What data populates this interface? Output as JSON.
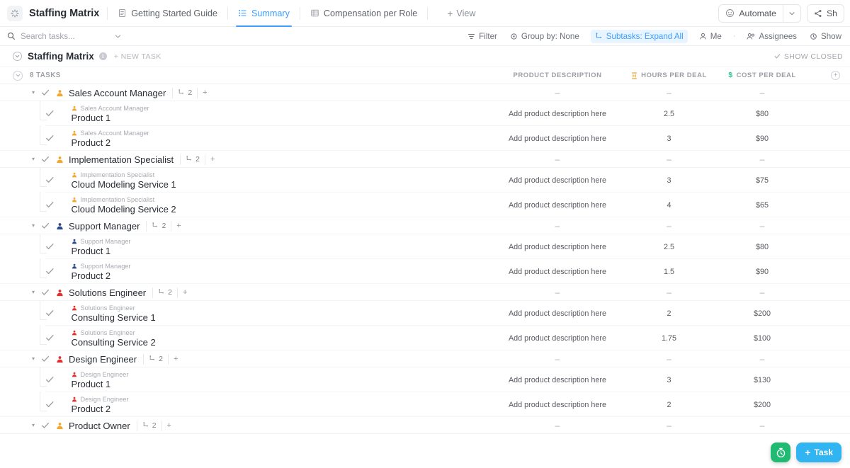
{
  "topbar": {
    "list_title": "Staffing Matrix",
    "tabs": [
      {
        "label": "Getting Started Guide",
        "icon": "doc-icon",
        "active": false
      },
      {
        "label": "Summary",
        "icon": "list-icon",
        "active": true
      },
      {
        "label": "Compensation per Role",
        "icon": "table-icon",
        "active": false
      }
    ],
    "add_view_label": "View",
    "automate_label": "Automate",
    "share_label": "Sh"
  },
  "filterbar": {
    "search_placeholder": "Search tasks...",
    "filter_label": "Filter",
    "group_by_label": "Group by: None",
    "subtasks_label": "Subtasks: Expand All",
    "me_label": "Me",
    "assignees_label": "Assignees",
    "show_label": "Show"
  },
  "listheader": {
    "title": "Staffing Matrix",
    "info_glyph": "i",
    "new_task_label": "+ NEW TASK",
    "show_closed_label": "SHOW CLOSED"
  },
  "columns": {
    "task_count": "8 TASKS",
    "product_description": "PRODUCT DESCRIPTION",
    "hours_per_deal": "HOURS PER DEAL",
    "cost_per_deal": "COST PER DEAL",
    "hours_icon": "hourglass-icon",
    "cost_icon": "dollar-icon",
    "add_column_icon": "plus-circle-icon"
  },
  "empty_value": "–",
  "colors": {
    "accent": "#3c9dff",
    "highlight_bg": "#e8f4ff",
    "fab_green": "#21ba72",
    "fab_blue": "#30b5f2",
    "avatar_orange": "#f0a830",
    "avatar_navy": "#2c4a8c",
    "avatar_red": "#e03131"
  },
  "groups": [
    {
      "name": "Sales Account Manager",
      "avatar": "person-orange-icon",
      "avatar_color": "#f0a830",
      "subtask_count": "2",
      "add_label": "+",
      "parent_cells": {
        "desc": "–",
        "hours": "–",
        "cost": "–"
      },
      "subtasks": [
        {
          "tag": "Sales Account Manager",
          "name": "Product 1",
          "desc": "Add product description here",
          "hours": "2.5",
          "cost": "$80"
        },
        {
          "tag": "Sales Account Manager",
          "name": "Product 2",
          "desc": "Add product description here",
          "hours": "3",
          "cost": "$90"
        }
      ]
    },
    {
      "name": "Implementation Specialist",
      "avatar": "person-orange-icon",
      "avatar_color": "#f0a830",
      "subtask_count": "2",
      "add_label": "+",
      "parent_cells": {
        "desc": "–",
        "hours": "–",
        "cost": "–"
      },
      "subtasks": [
        {
          "tag": "Implementation Specialist",
          "name": "Cloud Modeling Service 1",
          "desc": "Add product description here",
          "hours": "3",
          "cost": "$75"
        },
        {
          "tag": "Implementation Specialist",
          "name": "Cloud Modeling Service 2",
          "desc": "Add product description here",
          "hours": "4",
          "cost": "$65"
        }
      ]
    },
    {
      "name": "Support Manager",
      "avatar": "person-navy-icon",
      "avatar_color": "#2c4a8c",
      "subtask_count": "2",
      "add_label": "+",
      "parent_cells": {
        "desc": "–",
        "hours": "–",
        "cost": "–"
      },
      "subtasks": [
        {
          "tag": "Support Manager",
          "name": "Product 1",
          "desc": "Add product description here",
          "hours": "2.5",
          "cost": "$80"
        },
        {
          "tag": "Support Manager",
          "name": "Product 2",
          "desc": "Add product description here",
          "hours": "1.5",
          "cost": "$90"
        }
      ]
    },
    {
      "name": "Solutions Engineer",
      "avatar": "person-red-icon",
      "avatar_color": "#e03131",
      "subtask_count": "2",
      "add_label": "+",
      "parent_cells": {
        "desc": "–",
        "hours": "–",
        "cost": "–"
      },
      "subtasks": [
        {
          "tag": "Solutions Engineer",
          "name": "Consulting Service 1",
          "desc": "Add product description here",
          "hours": "2",
          "cost": "$200"
        },
        {
          "tag": "Solutions Engineer",
          "name": "Consulting Service 2",
          "desc": "Add product description here",
          "hours": "1.75",
          "cost": "$100"
        }
      ]
    },
    {
      "name": "Design Engineer",
      "avatar": "person-red-icon",
      "avatar_color": "#e03131",
      "subtask_count": "2",
      "add_label": "+",
      "parent_cells": {
        "desc": "–",
        "hours": "–",
        "cost": "–"
      },
      "subtasks": [
        {
          "tag": "Design Engineer",
          "name": "Product 1",
          "desc": "Add product description here",
          "hours": "3",
          "cost": "$130"
        },
        {
          "tag": "Design Engineer",
          "name": "Product 2",
          "desc": "Add product description here",
          "hours": "2",
          "cost": "$200"
        }
      ]
    },
    {
      "name": "Product Owner",
      "avatar": "person-orange-icon",
      "avatar_color": "#f0a830",
      "subtask_count": "2",
      "add_label": "+",
      "parent_cells": {
        "desc": "–",
        "hours": "–",
        "cost": "–"
      },
      "subtasks": []
    }
  ],
  "fabs": {
    "timer_icon": "stopwatch-icon",
    "task_label": "Task",
    "task_plus": "+"
  }
}
